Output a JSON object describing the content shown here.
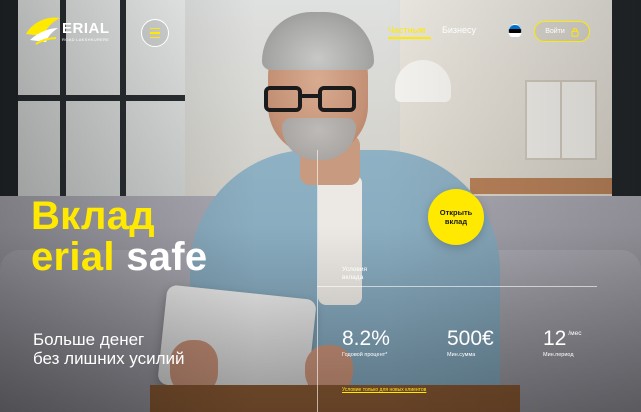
{
  "brand": {
    "name": "ERIAL",
    "tagline": "ROAD LAKSHKURERE"
  },
  "nav": {
    "private_label": "Частным",
    "business_label": "Бизнесу",
    "login_label": "Войти",
    "language_flag": "estonia-flag-icon"
  },
  "hero": {
    "title_line1": "Вклад",
    "title_line2_accent": "erial",
    "title_line2_rest": "safe",
    "subtitle_line1": "Больше денег",
    "subtitle_line2": "без лишних усилий",
    "cta_label_line1": "Открыть",
    "cta_label_line2": "вклад"
  },
  "conditions": {
    "label_line1": "Условия",
    "label_line2": "вклада",
    "stats": [
      {
        "value": "8.2%",
        "caption": "Годовой процент*"
      },
      {
        "value": "500€",
        "caption": "Мин.сумма"
      },
      {
        "value": "12",
        "suffix": "/мес",
        "caption": "Мин.период"
      }
    ],
    "footnote": "Условие только для новых клиентов"
  },
  "colors": {
    "accent": "#ffe900",
    "text": "#ffffff"
  }
}
